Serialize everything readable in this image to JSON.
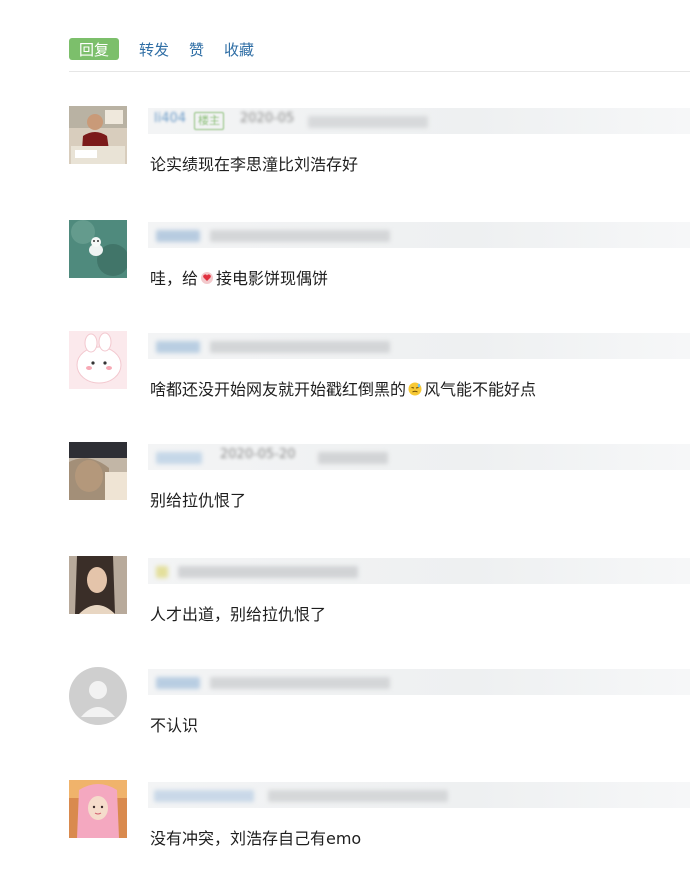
{
  "actions": {
    "reply": "回复",
    "repost": "转发",
    "like": "赞",
    "favorite": "收藏"
  },
  "colors": {
    "reply_bg": "#7cbf6b",
    "link": "#2f6ea5",
    "divider": "#e6e6e6",
    "blurred_meta_bg": "#eef0f1"
  },
  "comments": [
    {
      "avatar": "man-at-desk-photo",
      "nickname": "li404",
      "badge": "楼主",
      "time": "2020-05",
      "text": "论实绩现在李思潼比刘浩存好"
    },
    {
      "avatar": "white-cat-plush-photo",
      "text_before": "哇，给",
      "emoji": "heart-sticker-emoji",
      "text_after": "接电影饼现偶饼"
    },
    {
      "avatar": "pink-cartoon-bunny-avatar",
      "text_before": "啥都还没开始网友就开始戳红倒黑的",
      "emoji": "sweat-face-emoji",
      "text_after": " 风气能不能好点"
    },
    {
      "avatar": "girl-selfie-photo",
      "time": "2020-05-20",
      "text": "别给拉仇恨了"
    },
    {
      "avatar": "dark-hair-girl-photo",
      "text": "人才出道，别给拉仇恨了"
    },
    {
      "avatar": "default-gray-user-avatar",
      "text": "不认识"
    },
    {
      "avatar": "pink-hair-girl-photo",
      "text": "没有冲突，刘浩存自己有emo"
    }
  ]
}
